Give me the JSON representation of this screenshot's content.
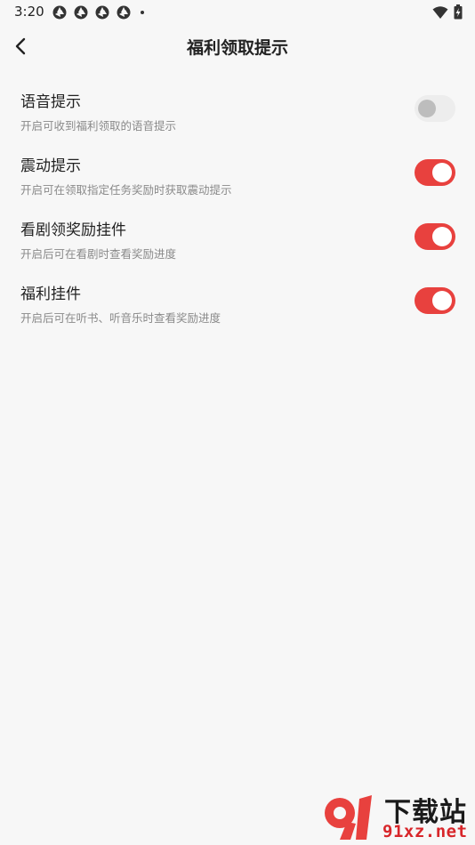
{
  "status_bar": {
    "time": "3:20"
  },
  "header": {
    "title": "福利领取提示"
  },
  "settings": [
    {
      "title": "语音提示",
      "description": "开启可收到福利领取的语音提示",
      "enabled": false
    },
    {
      "title": "震动提示",
      "description": "开启可在领取指定任务奖励时获取震动提示",
      "enabled": true
    },
    {
      "title": "看剧领奖励挂件",
      "description": "开启后可在看剧时查看奖励进度",
      "enabled": true
    },
    {
      "title": "福利挂件",
      "description": "开启后可在听书、听音乐时查看奖励进度",
      "enabled": true
    }
  ],
  "watermark": {
    "brand": "下载站",
    "url": "91xz.net",
    "logo_text": "91"
  },
  "colors": {
    "accent": "#e8413e",
    "background": "#f7f7f7",
    "switch_off": "#ededed"
  }
}
